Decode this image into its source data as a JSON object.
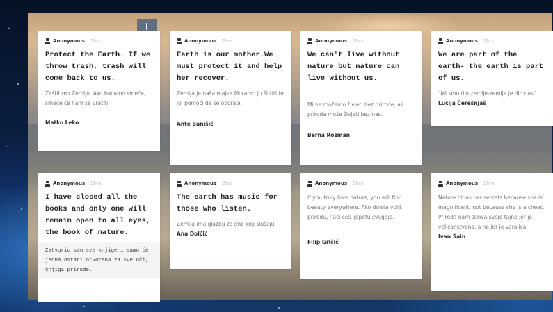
{
  "board": {
    "cards": [
      {
        "author": "Anonymous",
        "time": "2hrs",
        "title": "Protect the Earth. If we throw trash, trash will come back to us.",
        "body": "Zaštitimo Zemlju. Ako bacamo smeće, smeće će nam se vratiti.",
        "signature": "Matko Leko"
      },
      {
        "author": "Anonymous",
        "time": "2hrs",
        "title": "Earth is our mother.We must protect it and help her recover.",
        "body": "Zemlja je naša majka.Moramo ju štititi te joj pomoći da se oporavi.",
        "signature": "Ante Banišić"
      },
      {
        "author": "Anonymous",
        "time": "2hrs",
        "title": "We can't live without nature but nature can live without us.",
        "body": "Mi ne možemo živjeti bez prirode, ali priroda može živjeti bez nas.",
        "signature": "Berna Rozman"
      },
      {
        "author": "Anonymous",
        "time": "2hrs",
        "title": "We are part of the earth- the earth is part of us.",
        "body": "\"Mi smo dio zemlje-zemlja je dio nas\".",
        "signature": "Lucija Čerešnjaš"
      },
      {
        "author": "Anonymous",
        "time": "2hrs",
        "title": "I have closed all the books and only one will remain open to all eyes, the book of nature.",
        "body": "Zatvorio sam sve knjige i samo će jedna ostati otvorena za sve oči, knjiga prirode.",
        "signature": ""
      },
      {
        "author": "Anonymous",
        "time": "2hrs",
        "title": "The earth has music for those who listen.",
        "body": "Zemlja ima glazbu za one koji slušaju.",
        "signature": "Ana Dolčić"
      },
      {
        "author": "Anonymous",
        "time": "2hrs",
        "title": "",
        "body": "If you truly love nature, you will find beauty everywhere. Ako doista voliš prirodu, naći ćeš ljepotu svugdje.",
        "signature": "Filip Grlčić"
      },
      {
        "author": "Anonymous",
        "time": "2hrs",
        "title": "",
        "body": "Nature hides her secrets because she is magnificent, not because she is a cheat. Priroda nam skriva svoje tajne jer je veličanstvena, a ne jer je varalica.",
        "signature": "Ivan Šain"
      }
    ]
  }
}
